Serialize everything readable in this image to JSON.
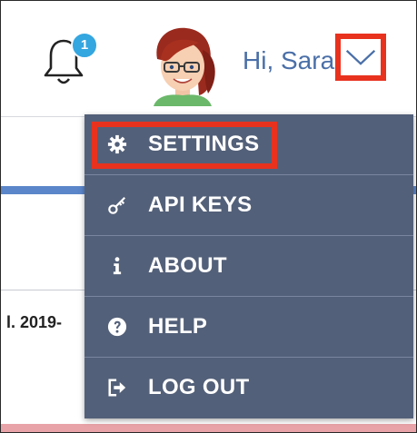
{
  "header": {
    "notification_count": "1",
    "greeting": "Hi, Sara"
  },
  "background": {
    "date_fragment": "l. 2019-"
  },
  "menu": {
    "items": [
      {
        "label": "SETTINGS",
        "icon": "gear-icon"
      },
      {
        "label": "API KEYS",
        "icon": "key-icon"
      },
      {
        "label": "ABOUT",
        "icon": "info-icon"
      },
      {
        "label": "HELP",
        "icon": "help-circle-icon"
      },
      {
        "label": "LOG OUT",
        "icon": "logout-icon"
      }
    ]
  },
  "colors": {
    "menu_background": "#536079",
    "highlight": "#e8321e",
    "greeting_text": "#4a6fa8",
    "badge": "#34a6e0"
  }
}
